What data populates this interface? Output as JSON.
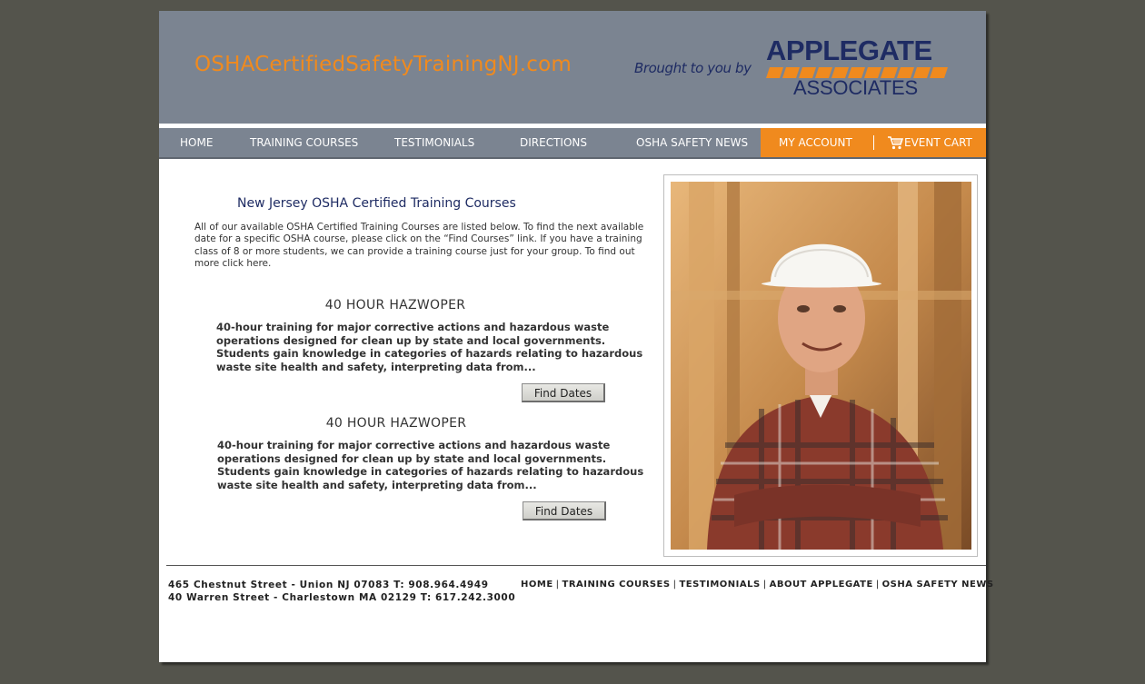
{
  "header": {
    "site_title": "OSHACertifiedSafetyTrainingNJ.com",
    "tagline": "Brought to you by",
    "logo": {
      "word1": "APPLEGATE",
      "word2": "ASSOCIATES"
    }
  },
  "nav": {
    "items": [
      {
        "label": "HOME"
      },
      {
        "label": "TRAINING COURSES"
      },
      {
        "label": "TESTIMONIALS"
      },
      {
        "label": "DIRECTIONS"
      },
      {
        "label": "OSHA SAFETY NEWS"
      }
    ],
    "account_label": "MY ACCOUNT",
    "cart_label": "EVENT CART"
  },
  "main": {
    "heading": "New Jersey OSHA Certified Training Courses",
    "intro": "All of our available OSHA Certified Training Courses are listed below.  To find the next available date for a specific OSHA course, please click on the “Find Courses” link.  If you have a training class of 8 or more students, we can provide a training course just for your group.  To find out more click here.",
    "courses": [
      {
        "title": "40 HOUR HAZWOPER",
        "description": "40-hour training for major corrective actions and hazardous waste operations designed for clean up by state and local governments. Students gain knowledge in categories of hazards relating to hazardous waste site health and safety, interpreting data from...",
        "button_label": "Find Dates"
      },
      {
        "title": "40 HOUR HAZWOPER",
        "description": "40-hour training for major corrective actions and hazardous waste operations designed for clean up by state and local governments. Students gain knowledge in categories of hazards relating to hazardous waste site health and safety, interpreting data from...",
        "button_label": "Find Dates"
      }
    ]
  },
  "footer": {
    "address1": "465 Chestnut Street - Union NJ 07083 T: 908.964.4949",
    "address2": "40 Warren Street - Charlestown MA 02129 T: 617.242.3000",
    "links": [
      "HOME",
      "TRAINING COURSES",
      "TESTIMONIALS",
      "ABOUT APPLEGATE",
      "OSHA SAFETY NEWS"
    ],
    "separator": "|"
  },
  "colors": {
    "background": "#54544c",
    "header_gray": "#7b8491",
    "accent_orange": "#f08a1e",
    "navy": "#1e2b63"
  },
  "icons": {
    "cart": "shopping-cart-icon",
    "photo": "construction-worker-photo"
  }
}
